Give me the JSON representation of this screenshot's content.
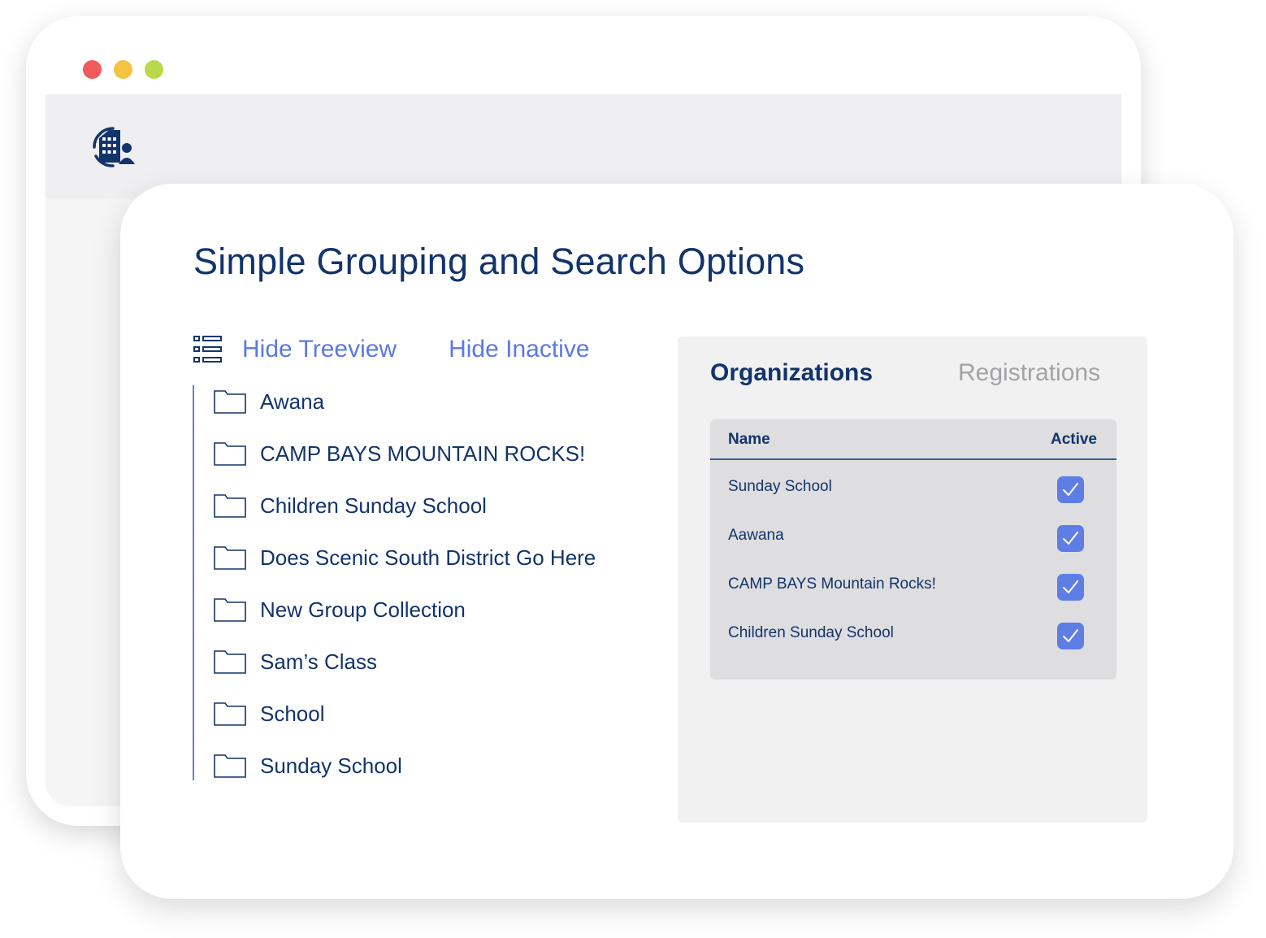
{
  "window": {
    "dots": [
      "#f05a5a",
      "#f5c242",
      "#b9d84a"
    ],
    "logo_icon": "building-user-icon"
  },
  "card": {
    "title": "Simple Grouping and Search Options"
  },
  "toolbar": {
    "tree_icon": "treeview-list-icon",
    "hide_treeview": "Hide Treeview",
    "hide_inactive": "Hide Inactive"
  },
  "tree": {
    "items": [
      {
        "label": "Awana"
      },
      {
        "label": "CAMP BAYS MOUNTAIN ROCKS!"
      },
      {
        "label": "Children Sunday School"
      },
      {
        "label": "Does Scenic South District Go Here"
      },
      {
        "label": "New Group Collection"
      },
      {
        "label": "Sam’s Class"
      },
      {
        "label": "School"
      },
      {
        "label": "Sunday School"
      }
    ]
  },
  "panel": {
    "tabs": [
      {
        "label": "Organizations",
        "active": true
      },
      {
        "label": "Registrations",
        "active": false
      }
    ],
    "table": {
      "columns": [
        "Name",
        "Active"
      ],
      "rows": [
        {
          "name": "Sunday School",
          "active": true
        },
        {
          "name": "Aawana",
          "active": true
        },
        {
          "name": "CAMP BAYS Mountain Rocks!",
          "active": true
        },
        {
          "name": "Children Sunday School",
          "active": true
        }
      ]
    }
  },
  "colors": {
    "navy": "#12346b",
    "accent_blue": "#5b79e2",
    "checkbox_blue": "#5e7ee6",
    "muted_tab": "#a3a3a6"
  }
}
